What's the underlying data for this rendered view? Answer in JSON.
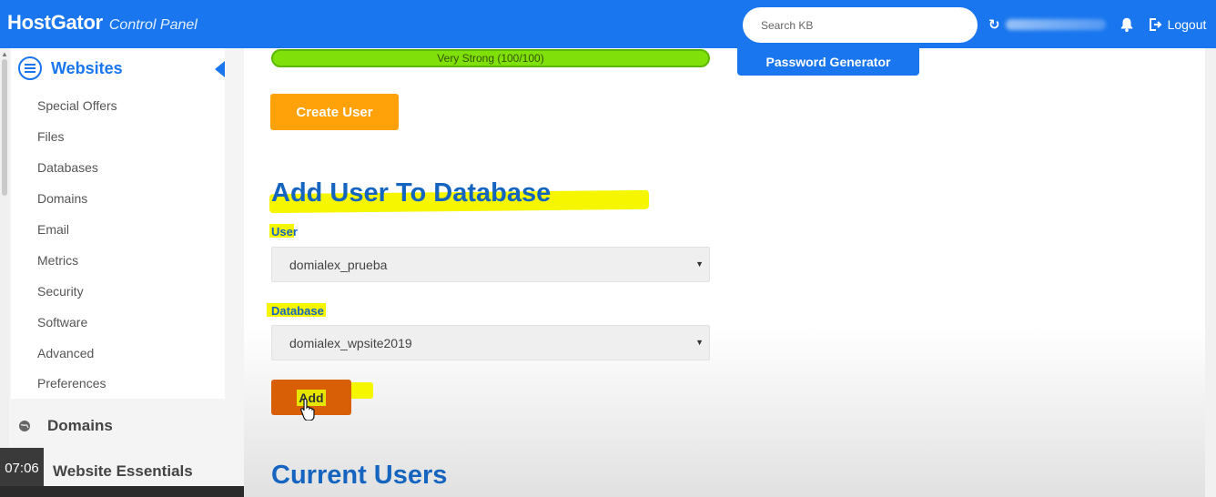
{
  "header": {
    "brand_name": "HostGator",
    "brand_sub": "Control Panel",
    "search_placeholder": "Search KB",
    "logout_label": "Logout",
    "colors": {
      "topbar": "#1976ee"
    },
    "icons": [
      "refresh-icon",
      "bell-icon",
      "logout-icon"
    ]
  },
  "sidebar": {
    "section_title": "Websites",
    "items": [
      {
        "label": "Special Offers"
      },
      {
        "label": "Files"
      },
      {
        "label": "Databases"
      },
      {
        "label": "Domains"
      },
      {
        "label": "Email"
      },
      {
        "label": "Metrics"
      },
      {
        "label": "Security"
      },
      {
        "label": "Software"
      },
      {
        "label": "Advanced"
      },
      {
        "label": "Preferences"
      }
    ],
    "sections": [
      {
        "label": "Domains",
        "icon": "globe-icon"
      },
      {
        "label": "Website Essentials"
      }
    ],
    "video_timestamp": "07:06"
  },
  "main": {
    "strength_text": "Very Strong (100/100)",
    "password_generator_label": "Password Generator",
    "create_user_label": "Create User",
    "add_user_heading": "Add User To Database",
    "user_label": "User",
    "user_value": "domialex_prueba",
    "database_label": "Database",
    "database_value": "domialex_wpsite2019",
    "add_label": "Add",
    "current_users_heading": "Current Users",
    "colors": {
      "heading": "#1565c0",
      "create_button": "#ffa20a",
      "add_button": "#d95f07",
      "strength_bar": "#7fe00a",
      "highlight": "#f6f600"
    }
  }
}
